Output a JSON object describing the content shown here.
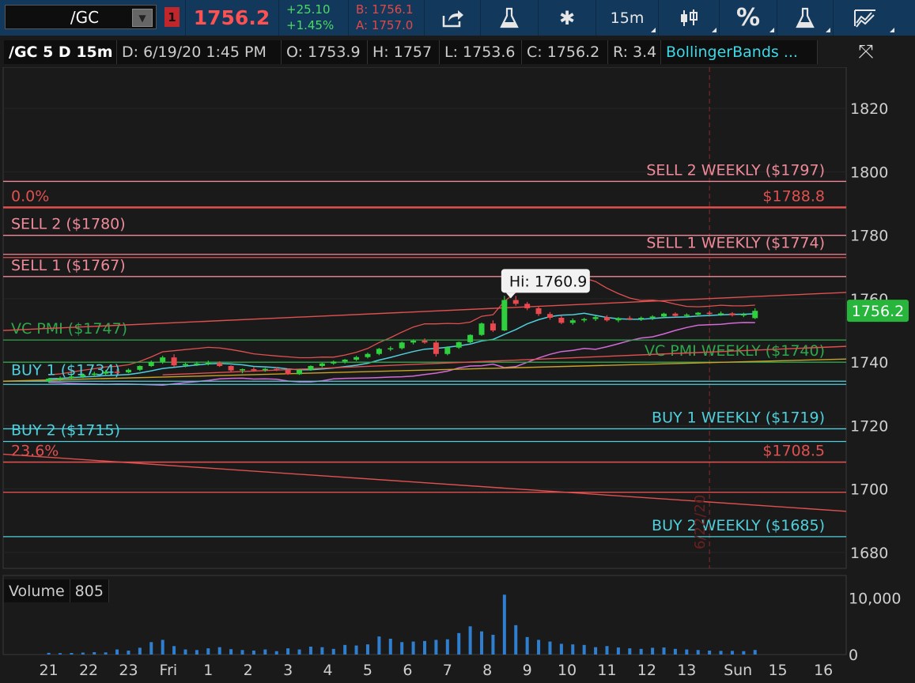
{
  "toolbar": {
    "symbol": "/GC",
    "alert_count": "1",
    "last": "1756.2",
    "change": "+25.10",
    "change_pct": "+1.45%",
    "bid": "B: 1756.1",
    "ask": "A: 1757.0",
    "interval": "15m",
    "percent": "%"
  },
  "infobar": {
    "title": "/GC 5 D 15m",
    "date": "D: 6/19/20 1:45 PM",
    "open": "O: 1753.9",
    "high": "H: 1757",
    "low": "L: 1753.6",
    "close": "C: 1756.2",
    "range": "R: 3.4",
    "study": "BollingerBands ..."
  },
  "volume": {
    "label": "Volume",
    "value": "805"
  },
  "colors": {
    "background": "#1a1a1a",
    "red_line": "#e0504f",
    "pink_line": "#f08a9a",
    "green_line": "#2ca84a",
    "cyan_line": "#4ed0dc",
    "up_candle": "#2ed13d",
    "down_candle": "#e8484e",
    "volume_bar": "#2f7fd0"
  },
  "chart_data": {
    "type": "candlestick",
    "price_axis": {
      "ylim": [
        1675,
        1833
      ],
      "ticks": [
        1680,
        1700,
        1720,
        1740,
        1760,
        1780,
        1800,
        1820
      ],
      "last_label": "1756.2"
    },
    "volume_axis": {
      "ylim": [
        0,
        14000
      ],
      "ticks": [
        0,
        10000
      ],
      "tick_labels": [
        "0",
        "10,000"
      ]
    },
    "x_labels": [
      "21",
      "22",
      "23",
      "Fri",
      "1",
      "2",
      "3",
      "4",
      "5",
      "6",
      "7",
      "8",
      "9",
      "10",
      "11",
      "12",
      "13",
      "Sun",
      "15",
      "16"
    ],
    "x_label_index": [
      0,
      3.5,
      7,
      10.5,
      14,
      17.5,
      21,
      24.5,
      28,
      31.5,
      35,
      38.5,
      42,
      45.5,
      49,
      52.5,
      56,
      60.5,
      64,
      68
    ],
    "x_range": [
      -4,
      70
    ],
    "levels": [
      {
        "label": "SELL 2 WEEKLY ($1797)",
        "price": 1797,
        "color": "pink",
        "side": "right"
      },
      {
        "label": "$1788.8",
        "price": 1788.8,
        "color": "red",
        "side": "right",
        "thick": true
      },
      {
        "label": "0.0%",
        "price": 1788.8,
        "color": "red",
        "side": "left"
      },
      {
        "label": "SELL 2 ($1780)",
        "price": 1780,
        "color": "pink",
        "side": "left"
      },
      {
        "label": "SELL 1 WEEKLY ($1774)",
        "price": 1774,
        "color": "pink",
        "side": "right"
      },
      {
        "label": "",
        "price": 1773,
        "color": "red",
        "side": "none"
      },
      {
        "label": "SELL 1 ($1767)",
        "price": 1767,
        "color": "pink",
        "side": "left"
      },
      {
        "label": "VC PMI ($1747)",
        "price": 1747,
        "color": "green",
        "side": "left"
      },
      {
        "label": "VC PMI WEEKLY ($1740)",
        "price": 1740,
        "color": "green",
        "side": "right"
      },
      {
        "label": "BUY 1 ($1734)",
        "price": 1734,
        "color": "cyan",
        "side": "left"
      },
      {
        "label": "",
        "price": 1733,
        "color": "cyan",
        "side": "none"
      },
      {
        "label": "BUY 1 WEEKLY ($1719)",
        "price": 1719,
        "color": "cyan",
        "side": "right"
      },
      {
        "label": "BUY 2 ($1715)",
        "price": 1715,
        "color": "cyan",
        "side": "left"
      },
      {
        "label": "$1708.5",
        "price": 1708.5,
        "color": "red",
        "side": "right"
      },
      {
        "label": "23.6%",
        "price": 1708.5,
        "color": "red",
        "side": "left"
      },
      {
        "label": "",
        "price": 1699,
        "color": "red",
        "side": "none"
      },
      {
        "label": "BUY 2 WEEKLY ($1685)",
        "price": 1685,
        "color": "cyan",
        "side": "right"
      }
    ],
    "trendlines": [
      {
        "from": [
          -4,
          1750
        ],
        "to": [
          70,
          1762
        ],
        "color": "red"
      },
      {
        "from": [
          -4,
          1711
        ],
        "to": [
          70,
          1693
        ],
        "color": "red"
      },
      {
        "from": [
          10,
          1736
        ],
        "to": [
          70,
          1745
        ],
        "color": "red"
      },
      {
        "from": [
          -4,
          1734
        ],
        "to": [
          70,
          1741
        ],
        "color": "gold"
      }
    ],
    "annotation": {
      "text": "Hi: 1760.9",
      "index": 40,
      "price": 1760.9
    },
    "session_marker": {
      "index": 58,
      "text": "6/22/20"
    },
    "candles": [
      [
        1734,
        1735,
        1733.5,
        1734.8
      ],
      [
        1734.8,
        1735.5,
        1734,
        1735
      ],
      [
        1735,
        1736,
        1734.5,
        1735.5
      ],
      [
        1735.5,
        1736.5,
        1735,
        1736
      ],
      [
        1736,
        1737,
        1735.5,
        1736.4
      ],
      [
        1736.4,
        1737.5,
        1736,
        1737
      ],
      [
        1737,
        1737.8,
        1736.2,
        1736.8
      ],
      [
        1736.8,
        1738,
        1736.5,
        1737.6
      ],
      [
        1737.6,
        1739,
        1737.2,
        1738.8
      ],
      [
        1738.8,
        1740.5,
        1738.5,
        1740.1
      ],
      [
        1740.1,
        1742,
        1739.5,
        1741.5
      ],
      [
        1741.5,
        1742.5,
        1738.5,
        1739
      ],
      [
        1739,
        1739.8,
        1738.4,
        1739.4
      ],
      [
        1739.4,
        1740.2,
        1738.8,
        1739.6
      ],
      [
        1739.6,
        1740.5,
        1739,
        1739.8
      ],
      [
        1739.8,
        1740.3,
        1738.5,
        1738.8
      ],
      [
        1738.8,
        1739,
        1737,
        1737.4
      ],
      [
        1737.4,
        1738,
        1736.5,
        1737.8
      ],
      [
        1737.8,
        1738.4,
        1737,
        1737.5
      ],
      [
        1737.5,
        1738.2,
        1737,
        1737.9
      ],
      [
        1737.9,
        1738.5,
        1737.2,
        1737.6
      ],
      [
        1737.6,
        1738,
        1736,
        1736.2
      ],
      [
        1736.2,
        1737.8,
        1736,
        1737.6
      ],
      [
        1737.6,
        1739,
        1737.3,
        1738.8
      ],
      [
        1738.8,
        1739.8,
        1738.4,
        1739.6
      ],
      [
        1739.6,
        1740.5,
        1739.2,
        1740.2
      ],
      [
        1740.2,
        1741,
        1739.6,
        1740.8
      ],
      [
        1740.8,
        1742,
        1740.4,
        1741.6
      ],
      [
        1741.6,
        1743,
        1741.2,
        1742.6
      ],
      [
        1742.6,
        1744.5,
        1742.2,
        1744.2
      ],
      [
        1744.2,
        1745,
        1743.5,
        1744.4
      ],
      [
        1744.4,
        1746.5,
        1744,
        1746.2
      ],
      [
        1746.2,
        1747.2,
        1745.6,
        1746.8
      ],
      [
        1746.8,
        1747.5,
        1745.8,
        1746.2
      ],
      [
        1746.2,
        1746.8,
        1741.8,
        1742.6
      ],
      [
        1742.6,
        1745,
        1742.2,
        1744.6
      ],
      [
        1744.6,
        1746.5,
        1744.2,
        1746.3
      ],
      [
        1746.3,
        1748.8,
        1746,
        1748.6
      ],
      [
        1748.6,
        1752.5,
        1748.3,
        1752.2
      ],
      [
        1752.2,
        1753.2,
        1749.5,
        1750
      ],
      [
        1750,
        1760.9,
        1749.8,
        1759.6
      ],
      [
        1759.6,
        1760.9,
        1757.8,
        1758.4
      ],
      [
        1758.4,
        1759,
        1756.4,
        1757
      ],
      [
        1757,
        1757.6,
        1754.6,
        1755.2
      ],
      [
        1755.2,
        1755.8,
        1753.4,
        1754
      ],
      [
        1754,
        1754.8,
        1752,
        1752.4
      ],
      [
        1752.4,
        1753.8,
        1751.8,
        1753.2
      ],
      [
        1753.2,
        1754,
        1752.6,
        1753.6
      ],
      [
        1753.6,
        1754.6,
        1753,
        1754.2
      ],
      [
        1754.2,
        1754.8,
        1752.8,
        1753.2
      ],
      [
        1753.2,
        1754.2,
        1752.6,
        1753.9
      ],
      [
        1753.9,
        1754.6,
        1753.2,
        1753.7
      ],
      [
        1753.7,
        1754.4,
        1753,
        1754
      ],
      [
        1754,
        1754.8,
        1753.3,
        1754.4
      ],
      [
        1754.4,
        1755.6,
        1754,
        1755.3
      ],
      [
        1755.3,
        1755.7,
        1754.2,
        1754.6
      ],
      [
        1754.6,
        1755.4,
        1754,
        1755
      ],
      [
        1755,
        1755.8,
        1754.5,
        1755.6
      ],
      [
        1755.6,
        1756.2,
        1754.8,
        1755.2
      ],
      [
        1755.2,
        1756,
        1754.6,
        1755.4
      ],
      [
        1755.4,
        1755.8,
        1754.4,
        1754.8
      ],
      [
        1754.8,
        1755.6,
        1754.2,
        1755.1
      ],
      [
        1753.9,
        1757,
        1753.6,
        1756.2
      ]
    ],
    "volume": [
      300,
      250,
      280,
      350,
      420,
      380,
      900,
      700,
      1200,
      2200,
      2600,
      1500,
      900,
      800,
      1100,
      1300,
      950,
      800,
      700,
      900,
      600,
      1100,
      900,
      1400,
      1300,
      1000,
      1700,
      1600,
      1800,
      3200,
      2800,
      2200,
      2300,
      2400,
      2600,
      2700,
      3800,
      5000,
      4100,
      3500,
      10600,
      5200,
      3100,
      2600,
      2300,
      1900,
      1800,
      1700,
      1300,
      1500,
      1250,
      1100,
      1000,
      1200,
      1250,
      1000,
      900,
      800,
      700,
      650,
      650,
      600,
      805
    ],
    "bands": {
      "upper_offset": 5,
      "lower_offset": -5
    }
  }
}
